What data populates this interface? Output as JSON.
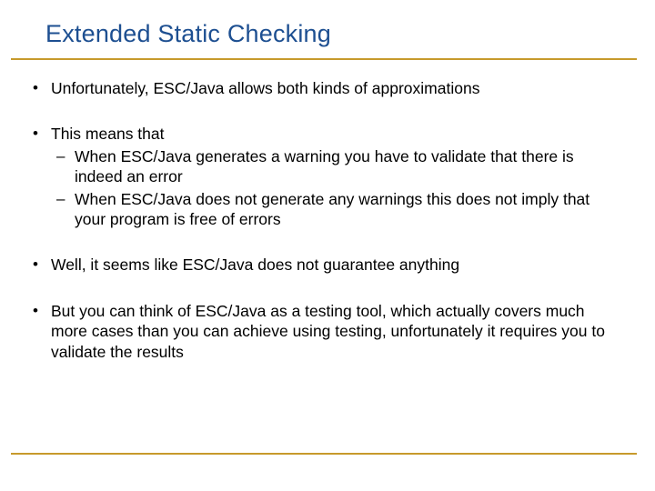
{
  "title": "Extended Static Checking",
  "bullets": {
    "b1": "Unfortunately, ESC/Java allows both kinds of approximations",
    "b2": "This means that",
    "b2a": "When ESC/Java generates a warning you have to validate that there is indeed an error",
    "b2b": "When ESC/Java does not generate any warnings this does not imply that your program is free of errors",
    "b3": "Well, it seems like ESC/Java does not guarantee anything",
    "b4": "But you can think of ESC/Java as a testing tool, which actually covers much more cases than you can achieve using testing, unfortunately it requires you to validate the results"
  }
}
